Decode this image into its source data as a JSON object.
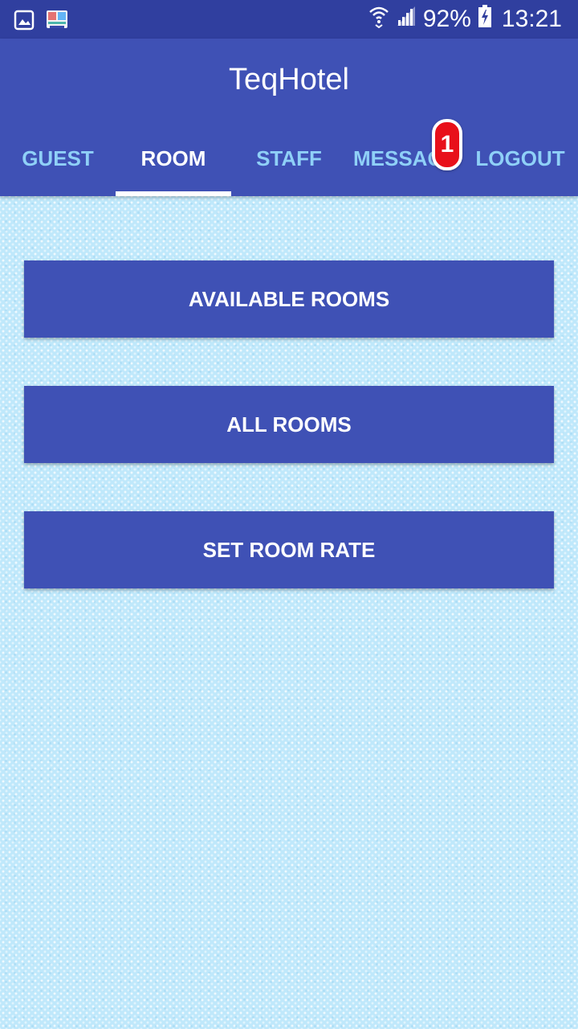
{
  "status_bar": {
    "icons": [
      "gallery-icon",
      "app-notification-icon",
      "wifi-icon",
      "cell-signal-icon",
      "battery-charging-icon"
    ],
    "battery_percent": "92%",
    "time": "13:21"
  },
  "app": {
    "title": "TeqHotel"
  },
  "tabs": [
    {
      "label": "GUEST",
      "active": false
    },
    {
      "label": "ROOM",
      "active": true
    },
    {
      "label": "STAFF",
      "active": false
    },
    {
      "label": "MESSAGES",
      "active": false
    },
    {
      "label": "LOGOUT",
      "active": false
    }
  ],
  "messages_badge": "1",
  "buttons": {
    "available_rooms": "AVAILABLE ROOMS",
    "all_rooms": "ALL ROOMS",
    "set_room_rate": "SET ROOM RATE"
  },
  "colors": {
    "status_bar": "#303f9f",
    "primary": "#3f51b5",
    "tab_inactive": "#8fd0f7",
    "tab_active": "#ffffff",
    "badge": "#e8101a",
    "background": "#bfe8fb"
  }
}
